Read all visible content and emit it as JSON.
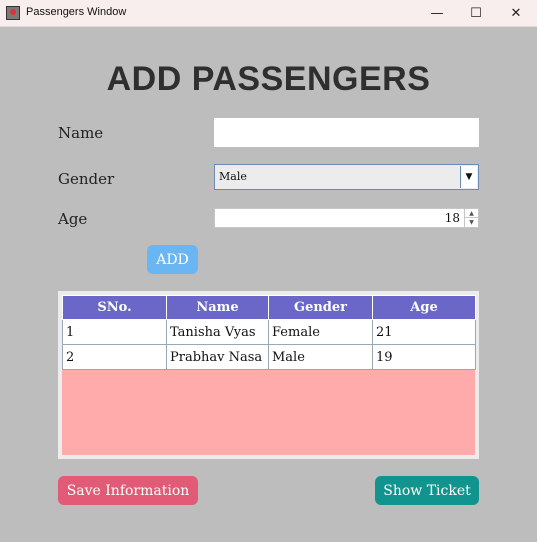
{
  "window": {
    "title": "Passengers Window",
    "minimize_glyph": "—",
    "maximize_glyph": "☐",
    "close_glyph": "✕"
  },
  "form": {
    "heading": "ADD PASSENGERS",
    "name_label": "Name",
    "name_value": "",
    "gender_label": "Gender",
    "gender_selected": "Male",
    "age_label": "Age",
    "age_value": "18",
    "add_label": "ADD"
  },
  "table": {
    "columns": [
      "SNo.",
      "Name",
      "Gender",
      "Age"
    ],
    "rows": [
      [
        "1",
        "Tanisha Vyas",
        "Female",
        "21"
      ],
      [
        "2",
        "Prabhav Nasa",
        "Male",
        "19"
      ]
    ]
  },
  "actions": {
    "save_label": "Save Information",
    "ticket_label": "Show Ticket"
  },
  "colors": {
    "background": "#bdbdbd",
    "add_button": "#6ab6f2",
    "save_button": "#e15a76",
    "ticket_button": "#12948e",
    "table_header": "#6a67c8",
    "table_empty_area": "#ffabab"
  },
  "icons": {
    "app": "java-app-icon",
    "dropdown": "chevron-down-icon",
    "spinner_up": "chevron-up-icon",
    "spinner_down": "chevron-down-icon"
  }
}
